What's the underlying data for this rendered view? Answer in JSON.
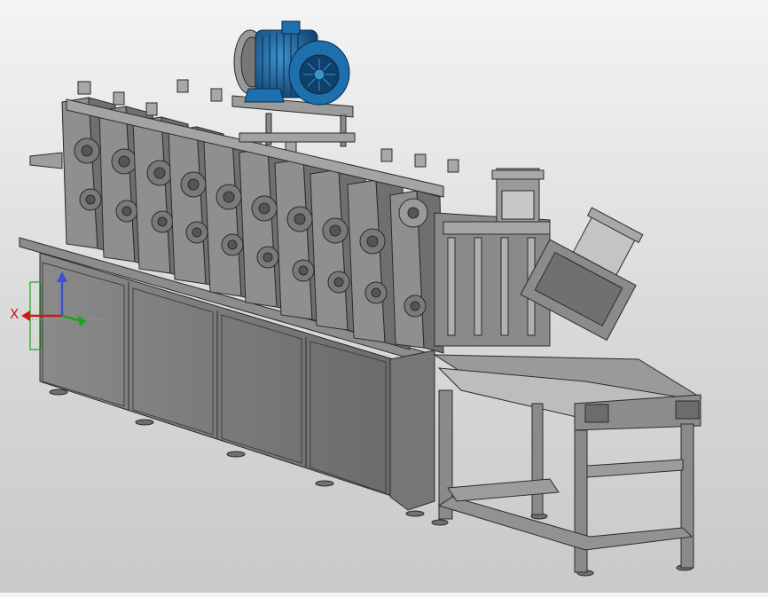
{
  "viewport": {
    "background_top": "#f4f4f4",
    "background_bottom": "#c9c9c9",
    "model": {
      "frame_color": "#7f7f7f",
      "frame_light": "#a8a8a8",
      "frame_dark": "#595959",
      "edge_color": "#2b2b2b",
      "motor_color": "#1e6fae",
      "motor_dark": "#0f3f6b"
    }
  },
  "view_triad": {
    "x_axis_label": "X",
    "x_color": "#d01818",
    "y_color": "#22a022",
    "z_color": "#3c4fd0"
  }
}
